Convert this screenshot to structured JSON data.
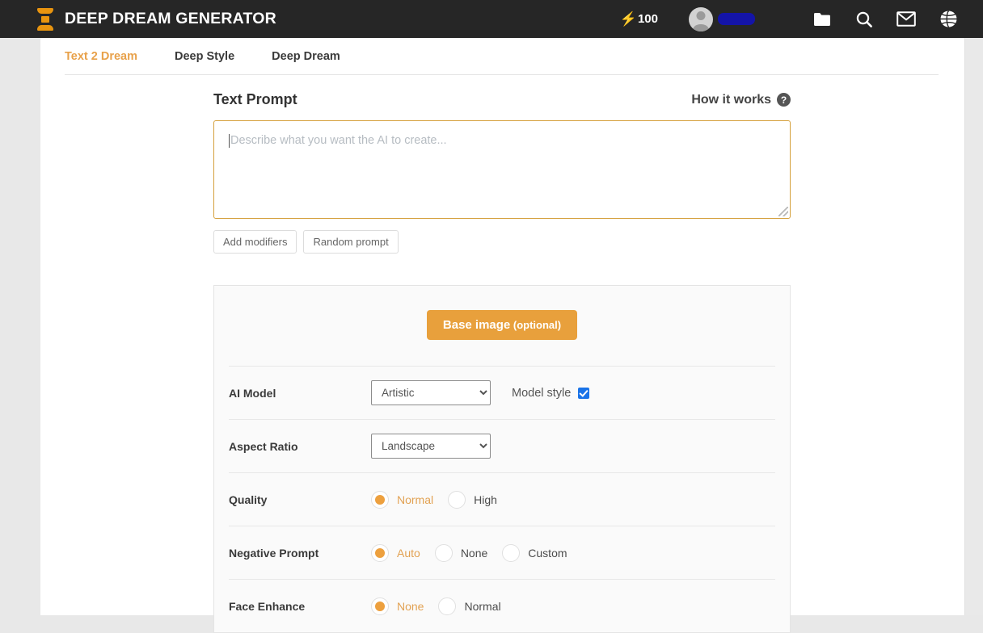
{
  "header": {
    "brand_title": "DEEP DREAM GENERATOR",
    "logo_icon": "hourglass-logo-icon",
    "credits": {
      "bolt_icon": "lightning-bolt-icon",
      "count": "100"
    },
    "username_redacted": "",
    "icons": [
      {
        "name": "folder-icon"
      },
      {
        "name": "search-icon"
      },
      {
        "name": "mail-icon"
      },
      {
        "name": "globe-icon"
      }
    ]
  },
  "tabs": [
    {
      "label": "Text 2 Dream",
      "active": true
    },
    {
      "label": "Deep Style",
      "active": false
    },
    {
      "label": "Deep Dream",
      "active": false
    }
  ],
  "prompt": {
    "title": "Text Prompt",
    "how_it_works": "How it works",
    "help_icon": "question-mark-icon",
    "placeholder": "Describe what you want the AI to create...",
    "value": "",
    "buttons": [
      {
        "label": "Add modifiers"
      },
      {
        "label": "Random prompt"
      }
    ]
  },
  "settings": {
    "base_image": {
      "label": "Base image",
      "optional": " (optional)"
    },
    "ai_model": {
      "label": "AI Model",
      "selected": "Artistic",
      "options": [
        "Artistic"
      ],
      "model_style_label": "Model style",
      "model_style_checked": true
    },
    "aspect_ratio": {
      "label": "Aspect Ratio",
      "selected": "Landscape",
      "options": [
        "Landscape"
      ]
    },
    "quality": {
      "label": "Quality",
      "options": [
        {
          "label": "Normal",
          "selected": true
        },
        {
          "label": "High",
          "selected": false
        }
      ]
    },
    "negative_prompt": {
      "label": "Negative Prompt",
      "options": [
        {
          "label": "Auto",
          "selected": true
        },
        {
          "label": "None",
          "selected": false
        },
        {
          "label": "Custom",
          "selected": false
        }
      ]
    },
    "face_enhance": {
      "label": "Face Enhance",
      "options": [
        {
          "label": "None",
          "selected": true
        },
        {
          "label": "Normal",
          "selected": false
        }
      ]
    }
  },
  "colors": {
    "accent": "#e8a03c",
    "topbar": "#262626",
    "checkbox": "#1a73e8"
  }
}
